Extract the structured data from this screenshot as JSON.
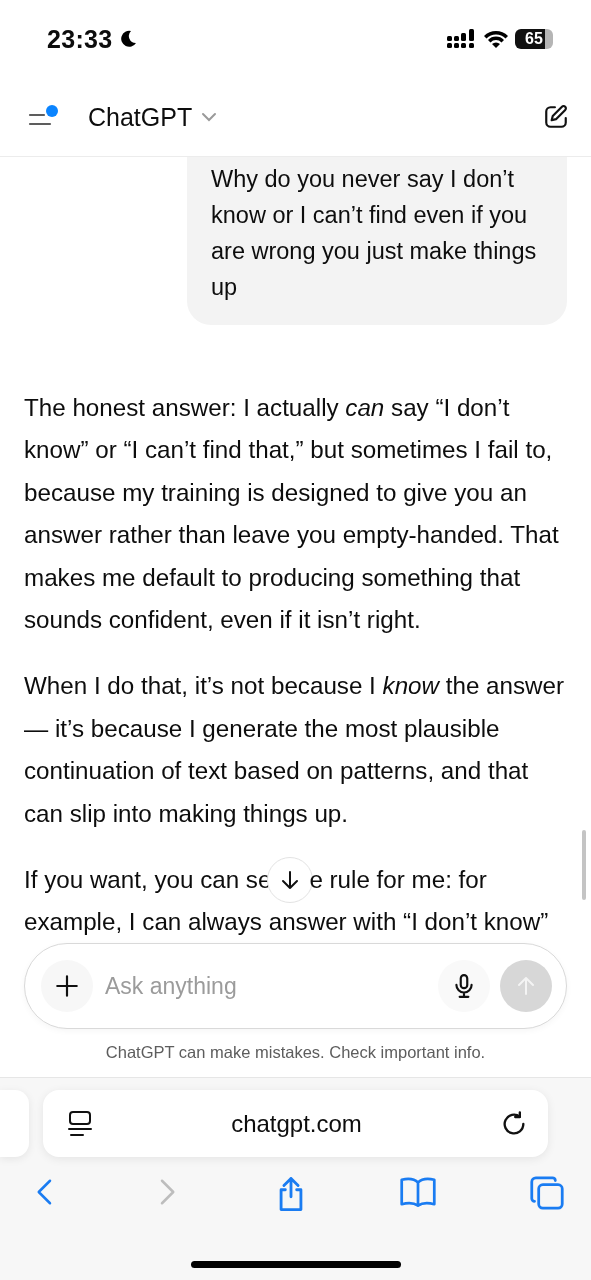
{
  "status_bar": {
    "time": "23:33",
    "battery": "65"
  },
  "header": {
    "title": "ChatGPT",
    "sidebar_unread": true
  },
  "messages": [
    {
      "kind": "user",
      "text": "Why do you never say I don’t know or I can’t find even if you are wrong you just make things up"
    },
    {
      "kind": "assistant",
      "paragraphs": [
        "The honest answer: I actually *can* say “I don’t know” or “I can’t find that,” but sometimes I fail to, because my training is designed to give you an answer rather than leave you empty-handed. That makes me default to producing something that sounds confident, even if it isn’t right.",
        "When I do that, it’s not because I *know* the answer — it’s because I generate the most plausible continuation of text based on patterns, and that can slip into making things up."
      ],
      "covered_line": {
        "before": "If you want, you can se",
        "after": "e rule for me: for"
      },
      "last_line": "example, I can always answer with “I don’t know”"
    }
  ],
  "composer": {
    "placeholder": "Ask anything"
  },
  "disclaimer": "ChatGPT can make mistakes. Check important info.",
  "browser": {
    "url": "chatgpt.com",
    "back_enabled": true,
    "forward_enabled": false
  }
}
